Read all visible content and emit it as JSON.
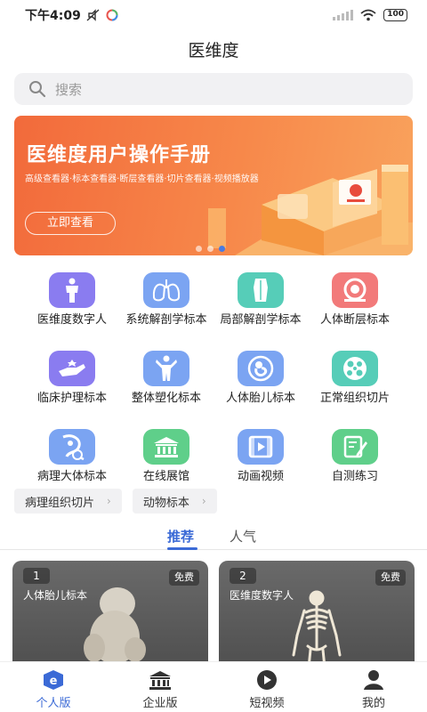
{
  "status_bar": {
    "time": "下午4:09",
    "battery": "100"
  },
  "header": {
    "title": "医维度"
  },
  "search": {
    "placeholder": "搜索"
  },
  "banner": {
    "title": "医维度用户操作手册",
    "subtitle": "高级查看器·标本查看器·断层查看器·切片查看器·视频播放器",
    "button": "立即查看",
    "active_dot": 3
  },
  "grid": [
    {
      "label": "医维度数字人",
      "icon": "human-body-icon",
      "color": "#8a7cf0"
    },
    {
      "label": "系统解剖学标本",
      "icon": "lungs-icon",
      "color": "#7ba4f2"
    },
    {
      "label": "局部解剖学标本",
      "icon": "torso-icon",
      "color": "#56cdb8"
    },
    {
      "label": "人体断层标本",
      "icon": "ct-scanner-icon",
      "color": "#f27a7a"
    },
    {
      "label": "临床护理标本",
      "icon": "care-hand-icon",
      "color": "#8a7cf0"
    },
    {
      "label": "整体塑化标本",
      "icon": "muscle-figure-icon",
      "color": "#7ba4f2"
    },
    {
      "label": "人体胎儿标本",
      "icon": "fetus-icon",
      "color": "#7ba4f2"
    },
    {
      "label": "正常组织切片",
      "icon": "tissue-slice-icon",
      "color": "#56cdb8"
    },
    {
      "label": "病理大体标本",
      "icon": "pathology-icon",
      "color": "#7ba4f2"
    },
    {
      "label": "在线展馆",
      "icon": "museum-icon",
      "color": "#5fcf8a"
    },
    {
      "label": "动画视频",
      "icon": "film-icon",
      "color": "#7ba4f2"
    },
    {
      "label": "自测练习",
      "icon": "quiz-icon",
      "color": "#5fcf8a"
    }
  ],
  "chips": [
    {
      "label": "病理组织切片"
    },
    {
      "label": "动物标本"
    }
  ],
  "tabs": [
    {
      "label": "推荐",
      "active": true
    },
    {
      "label": "人气",
      "active": false
    }
  ],
  "cards": [
    {
      "rank": "1",
      "title": "人体胎儿标本",
      "badge": "免费"
    },
    {
      "rank": "2",
      "title": "医维度数字人",
      "badge": "免费"
    }
  ],
  "bottom_nav": [
    {
      "label": "个人版",
      "icon": "personal-edition-icon",
      "active": true
    },
    {
      "label": "企业版",
      "icon": "enterprise-building-icon",
      "active": false
    },
    {
      "label": "短视频",
      "icon": "play-circle-icon",
      "active": false
    },
    {
      "label": "我的",
      "icon": "profile-icon",
      "active": false
    }
  ],
  "colors": {
    "accent": "#3b6ad6",
    "banner": "#f26a3b"
  }
}
